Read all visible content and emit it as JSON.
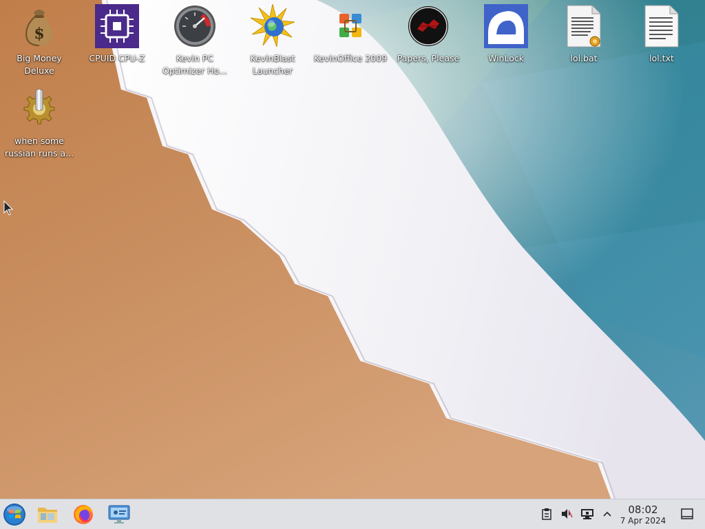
{
  "desktop": {
    "icons": [
      {
        "label": "Big Money Deluxe",
        "icon": "money-bag-icon"
      },
      {
        "label": "CPUID CPU-Z",
        "icon": "cpu-chip-icon"
      },
      {
        "label": "Kevin PC Optimizer Ho...",
        "icon": "speedometer-icon"
      },
      {
        "label": "KevinBlast Launcher",
        "icon": "sunburst-globe-icon"
      },
      {
        "label": "KevinOffice 2009",
        "icon": "office-logo-icon"
      },
      {
        "label": "Papers, Please",
        "icon": "papers-please-icon"
      },
      {
        "label": "WinLock",
        "icon": "lock-icon"
      },
      {
        "label": "lol.bat",
        "icon": "batch-file-icon"
      },
      {
        "label": "lol.txt",
        "icon": "text-file-icon"
      },
      {
        "label": "when some russian runs a...",
        "icon": "gear-executable-icon"
      }
    ]
  },
  "taskbar": {
    "start": {
      "icon": "start-orb-icon"
    },
    "pinned": [
      {
        "name": "File Explorer",
        "icon": "folder-icon"
      },
      {
        "name": "Firefox",
        "icon": "firefox-icon"
      },
      {
        "name": "Remote Desktop",
        "icon": "remote-desktop-icon"
      }
    ],
    "tray": [
      "clipboard-icon",
      "volume-muted-icon",
      "network-monitor-icon",
      "chevron-up-icon"
    ],
    "clock": {
      "time": "08:02",
      "date": "7 Apr 2024"
    },
    "show_desktop": {
      "icon": "show-desktop-icon"
    }
  },
  "colors": {
    "taskbar": "#dfe1e5",
    "sand": "#c58c5b",
    "sea": "#3d8b95",
    "foam": "#eef0f4"
  }
}
